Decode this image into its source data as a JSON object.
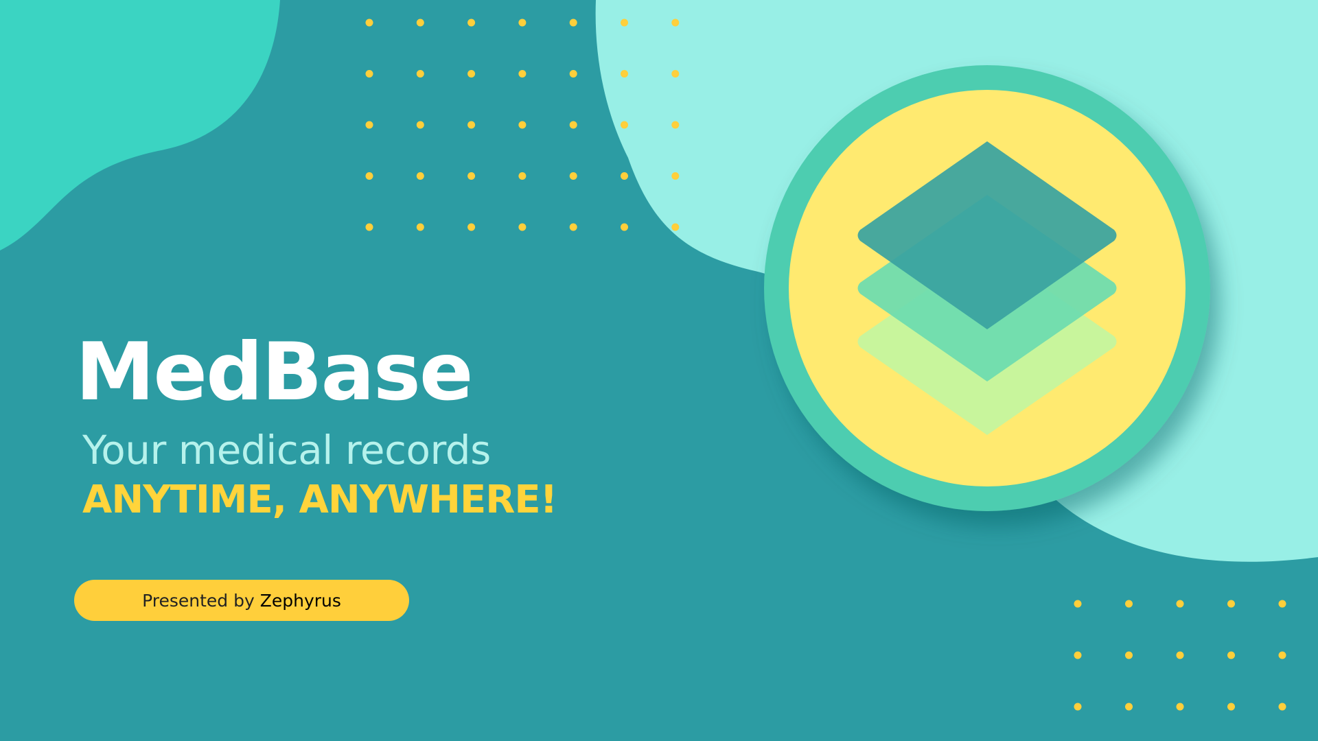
{
  "slide": {
    "title": "MedBase",
    "subtitle": "Your medical records",
    "tagline": "ANYTIME, ANYWHERE!",
    "presenter": {
      "prefix": "Presented by",
      "name": "Zephyrus"
    }
  },
  "colors": {
    "background": "#2c9ca3",
    "blob_left": "#3bd4c2",
    "blob_right": "#98efe6",
    "dots": "#ffcf3b",
    "logo_ring": "#4ecdb0",
    "logo_fill": "#ffea70",
    "layer_top": "#3aa3a0",
    "layer_mid": "#6bdbb0",
    "layer_bottom": "#c8f59c",
    "title": "#ffffff",
    "subtitle": "#b6f2ec",
    "tagline": "#ffd43b",
    "pill": "#ffcf3b"
  },
  "icons": {
    "logo": "stacked-layers-icon"
  }
}
